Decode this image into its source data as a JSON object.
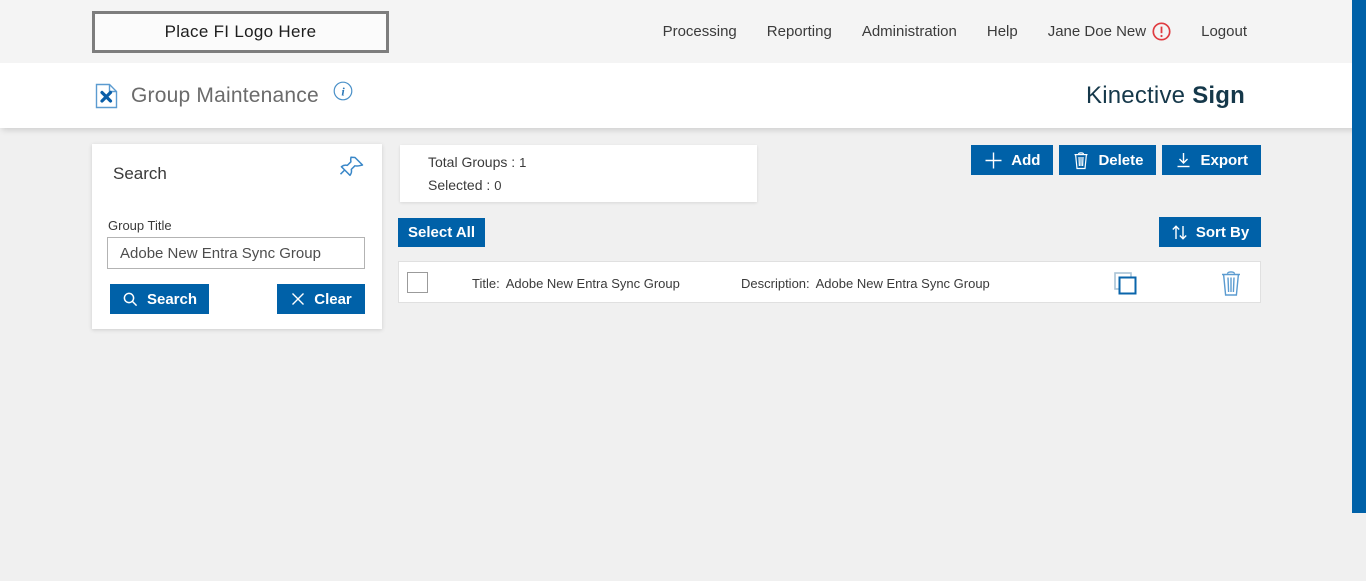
{
  "topbar": {
    "logo_placeholder": "Place FI Logo Here",
    "nav": [
      {
        "label": "Processing"
      },
      {
        "label": "Reporting"
      },
      {
        "label": "Administration"
      },
      {
        "label": "Help"
      },
      {
        "label": "Jane Doe New"
      },
      {
        "label": "Logout"
      }
    ]
  },
  "header": {
    "title": "Group Maintenance",
    "brand_name": "Kinective",
    "brand_product": "Sign"
  },
  "search_panel": {
    "title": "Search",
    "group_title_label": "Group Title",
    "group_title_value": "Adobe New Entra Sync Group",
    "search_button": "Search",
    "clear_button": "Clear"
  },
  "summary": {
    "total_groups_label": "Total Groups :",
    "total_groups_value": "1",
    "selected_label": "Selected :",
    "selected_value": "0"
  },
  "toolbar": {
    "add_label": "Add",
    "delete_label": "Delete",
    "export_label": "Export",
    "select_all_label": "Select All",
    "sort_by_label": "Sort By"
  },
  "groups": [
    {
      "title_label": "Title:",
      "title": "Adobe New Entra Sync Group",
      "description_label": "Description:",
      "description": "Adobe New Entra Sync Group"
    }
  ],
  "icons": {
    "user_status": "alert-circle-icon",
    "page": "document-tools-icon",
    "info": "info-icon",
    "pin": "pushpin-icon",
    "search": "magnifier-icon",
    "clear": "x-icon",
    "add": "plus-icon",
    "delete": "trash-icon",
    "export": "download-icon",
    "sort": "sort-arrows-icon",
    "copy": "copy-icon"
  },
  "colors": {
    "accent_blue": "#0061a8",
    "icon_blue": "#5b9bd0",
    "brand_dark": "#15384a",
    "alert_red": "#df3b40",
    "topbar_bg": "#f4f4f4",
    "page_bg": "#f0f0f0"
  }
}
